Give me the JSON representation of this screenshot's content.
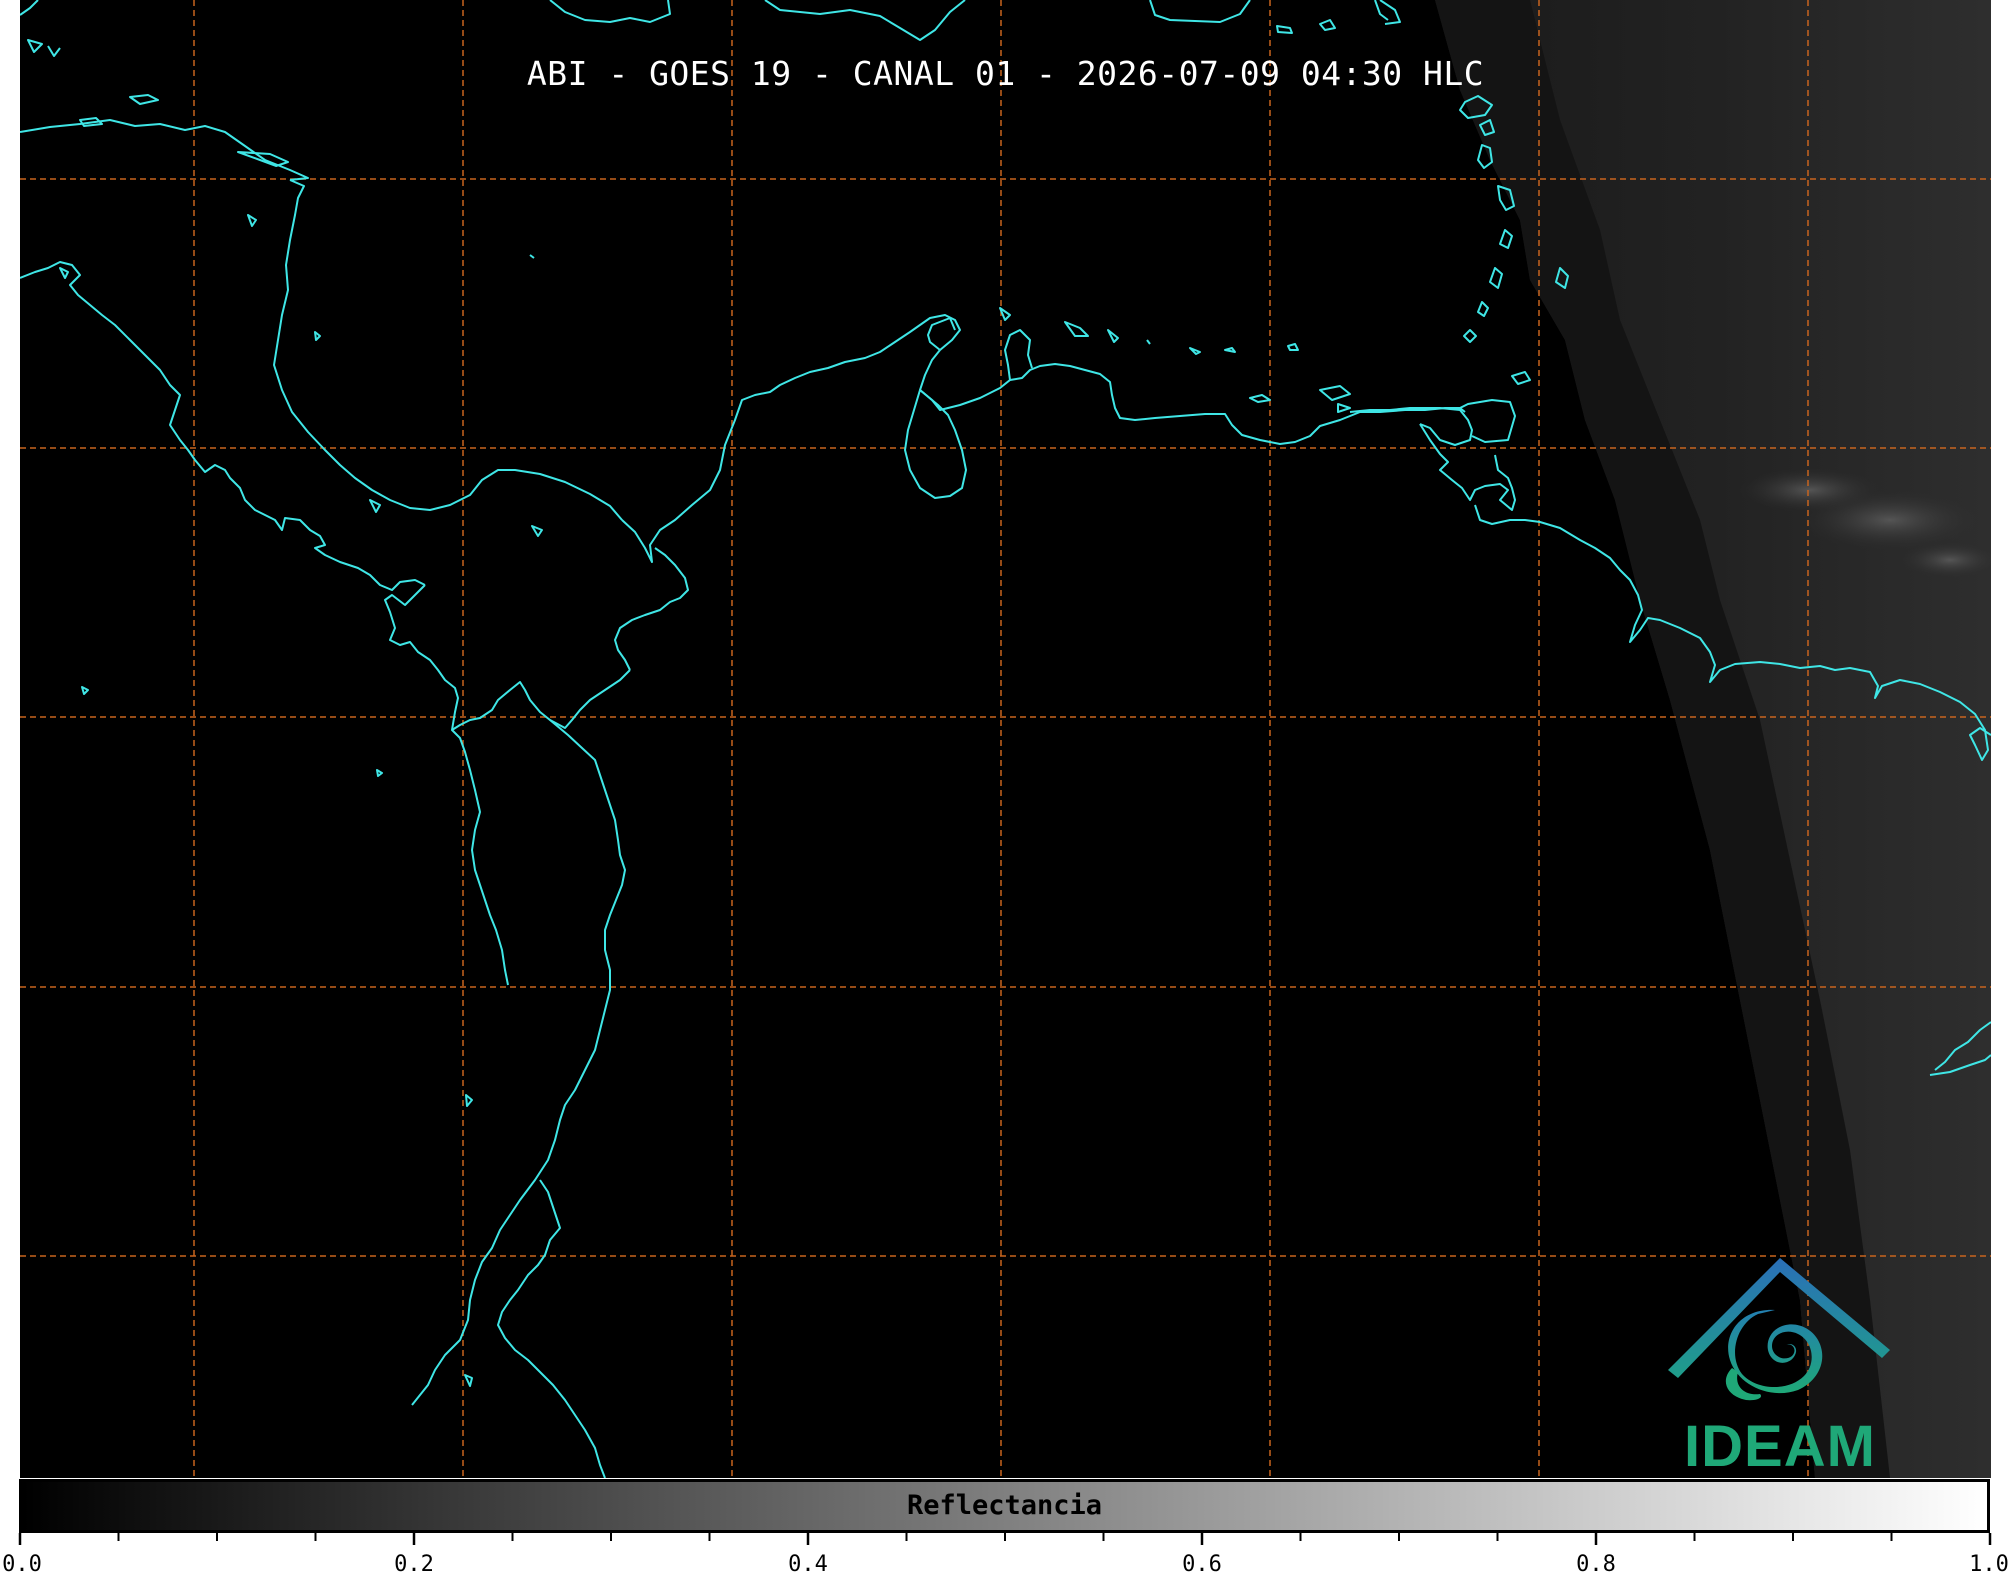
{
  "map": {
    "title": "ABI - GOES 19 - CANAL 01 - 2026-07-09 04:30 HLC",
    "background_color": "#000000",
    "coastline_color": "#3fe6e6",
    "gridline_color": "#c8641e",
    "gridline_style": "dashed"
  },
  "logo": {
    "text": "IDEAM",
    "text_color": "#1fa878",
    "roof_color": "#2a6fb8",
    "swirl_color": "#22a396"
  },
  "colorbar": {
    "label": "Reflectancia",
    "colormap": "gray",
    "range": [
      0.0,
      1.0
    ],
    "major_ticks": [
      "0.0",
      "0.2",
      "0.4",
      "0.6",
      "0.8",
      "1.0"
    ],
    "minor_tick_step": 0.05
  }
}
